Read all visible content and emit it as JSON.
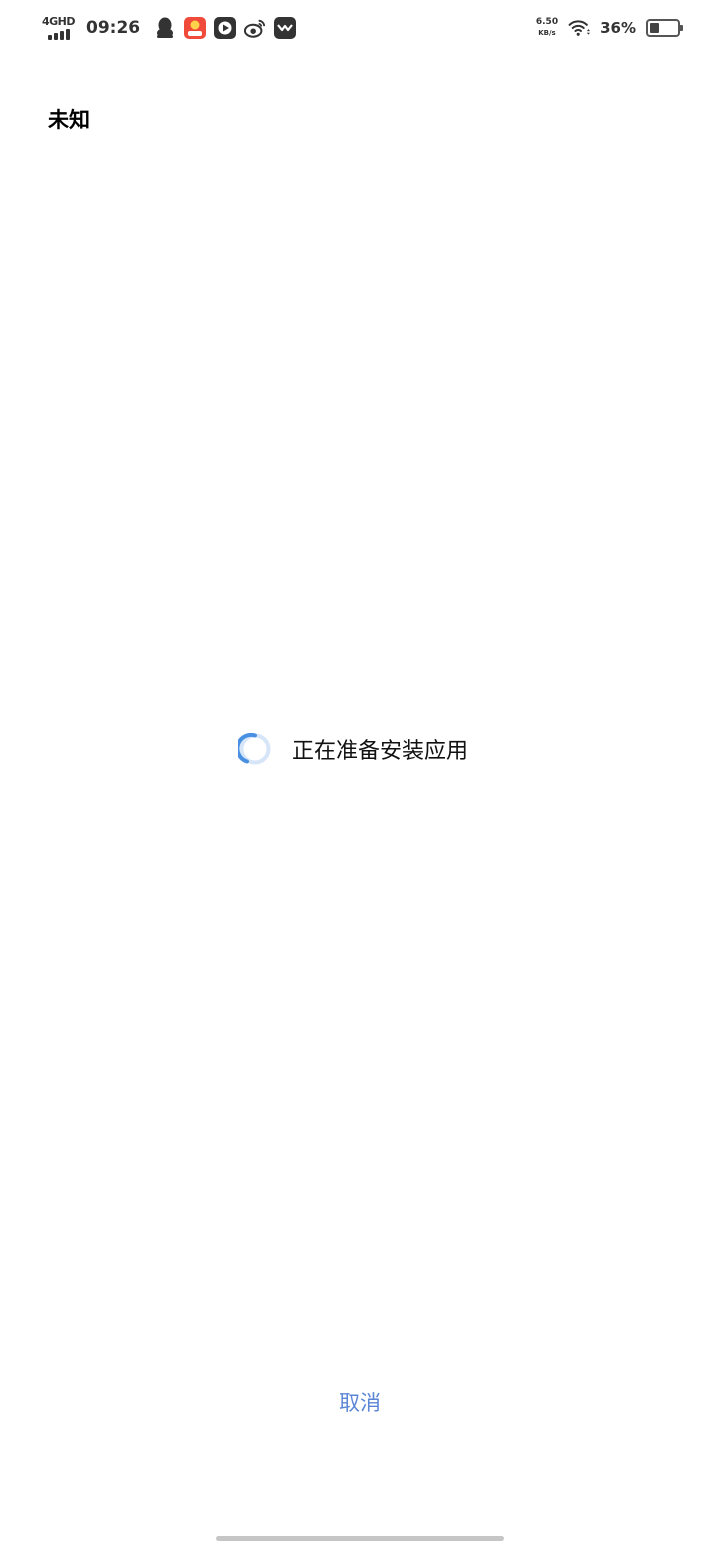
{
  "status_bar": {
    "network_type": "4GHD",
    "time": "09:26",
    "app_icons": [
      "qq-icon",
      "shopping-app-icon",
      "video-player-icon",
      "weibo-icon",
      "message-app-icon"
    ],
    "net_speed_value": "6.50",
    "net_speed_unit": "KB/s",
    "battery_percent": "36%",
    "battery_level": 0.36
  },
  "header": {
    "title": "未知"
  },
  "install": {
    "status_text": "正在准备安装应用",
    "spinner_color": "#4a90e2"
  },
  "actions": {
    "cancel_label": "取消",
    "accent_color": "#5b86d6"
  }
}
